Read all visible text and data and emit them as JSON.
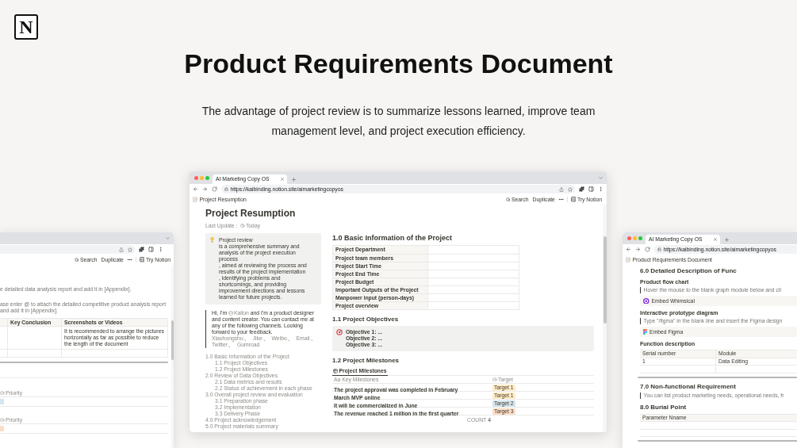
{
  "hero": {
    "logo": "N",
    "title": "Product Requirements Document",
    "subtitle": "The advantage of project review is to summarize lessons learned, improve team management level, and project execution efficiency."
  },
  "main_window": {
    "tab_title": "AI Marketing Copy OS",
    "url": "https://kaibinding.notion.site/aimarketingcopyos",
    "breadcrumb": "Project Resumption",
    "actions": {
      "search": "Search",
      "duplicate": "Duplicate",
      "try": "Try Notion"
    },
    "page_title": "Project Resumption",
    "last_update": {
      "label": "Last Update :",
      "value": "Today"
    },
    "callout": [
      "Project review",
      "is a comprehensive summary and analysis of the project execution process",
      ", aimed at reviewing the process and results of the project implementation",
      ", identifying problems and shortcomings, and providing improvement directions and lessons learned for future projects."
    ],
    "quote": {
      "intro": "Hi, I'm",
      "mention": "Kailon",
      "body": "and I'm a product designer and content creator. You can contact me at any of the following channels. Looking forward to your feedback.",
      "channels": "Xiaohongshu、 Jike、 Weibo、 Email、 Twitter、 Gumroad"
    },
    "toc": [
      {
        "label": "1.0 Basic Information of the Project",
        "children": [
          {
            "label": "1.1 Project Objectives"
          },
          {
            "label": "1.2 Project Milestones"
          }
        ]
      },
      {
        "label": "2.0 Review of Data Objectives",
        "children": [
          {
            "label": "2.1 Data metrics and results"
          },
          {
            "label": "2.2 Status of achievement in each phase"
          }
        ]
      },
      {
        "label": "3.0 Overall project review and evaluation",
        "children": [
          {
            "label": "3.1 Preparation phase"
          },
          {
            "label": "3.2 Implementation"
          },
          {
            "label": "3.3 Delivery Phase"
          }
        ]
      },
      {
        "label": "4.0 Project acknowledgement"
      },
      {
        "label": "5.0 Project materials summary"
      }
    ],
    "basic_info": {
      "heading": "1.0 Basic Information of the Project",
      "fields": [
        "Project Department",
        "Project team members",
        "Project Start Time",
        "Project End Time",
        "Project Budget",
        "Important Outputs of the Project",
        "Manpower input (person-days)",
        "Project overview"
      ]
    },
    "objectives": {
      "heading": "1.1 Project Objectives",
      "items": [
        "Objective 1: ...",
        "Objective 2: ...",
        "Objective 3: ..."
      ]
    },
    "milestones": {
      "heading": "1.2 Project Milestones",
      "views": [
        {
          "label": "Project Milestones",
          "selected": true
        }
      ],
      "columns": [
        "Aa Key Milestones",
        "Target"
      ],
      "rows": [
        {
          "name": "The project approval was completed in February",
          "target": "Target 1",
          "color": "#fdecc8"
        },
        {
          "name": "March MVP online",
          "target": "Target 1",
          "color": "#fdecc8"
        },
        {
          "name": "It will be commercialized in June",
          "target": "Target 2",
          "color": "#d3e5ef"
        },
        {
          "name": "The revenue reached 1 million in the first quarter",
          "target": "Target 3",
          "color": "#fadec9"
        }
      ],
      "count_label": "COUNT",
      "count": "4"
    }
  },
  "left_window": {
    "actions": {
      "search": "Search",
      "duplicate": "Duplicate",
      "try": "Try Notion"
    },
    "notes": [
      "e detailed data analysis report and add it in [Appendix].",
      "ase enter @ to attach the detailed competitive product analysis report and add it in [Appendix]."
    ],
    "table": {
      "columns": [
        "Key Conclusion",
        "Screenshots or Videos"
      ],
      "rows": [
        {
          "screenshots_or_videos": "It is recommended to arrange the pictures horizontally as far as possible to reduce the length of the document"
        }
      ]
    },
    "groups": [
      {
        "property": "Priority",
        "color": "#d3e5ef"
      },
      {
        "property": "Priority",
        "color": "#fadec9"
      }
    ]
  },
  "right_window": {
    "tab_title": "AI Marketing Copy OS",
    "url": "https://kaibinding.notion.site/aimarketingcopyos",
    "breadcrumb": "Product Requirements Document",
    "blocks": [
      {
        "kind": "heading",
        "text": "6.0 Detailed Description of Func"
      },
      {
        "kind": "subheading",
        "text": "Product flow chart"
      },
      {
        "kind": "quote",
        "text": "Hover the mouse to the blank graph module below and cli"
      },
      {
        "kind": "embed",
        "text": "Embed Whimsical"
      },
      {
        "kind": "subheading",
        "text": "Interactive prototype diagram"
      },
      {
        "kind": "quote",
        "text": "Type \"/figma\" in the blank line and insert the Figma design"
      },
      {
        "kind": "embed",
        "text": "Embed Figma"
      },
      {
        "kind": "subheading",
        "text": "Function description"
      },
      {
        "kind": "table",
        "columns": [
          "Serial number",
          "Module"
        ],
        "rows": [
          [
            "1",
            "Data Editing"
          ]
        ]
      },
      {
        "kind": "heading",
        "text": "7.0 Non-functional Requirement"
      },
      {
        "kind": "quote",
        "text": "You can list product marketing needs, operational needs, fr"
      },
      {
        "kind": "heading",
        "text": "8.0 Burial Point"
      },
      {
        "kind": "table",
        "columns": [
          "Parameter Nname"
        ]
      }
    ]
  }
}
